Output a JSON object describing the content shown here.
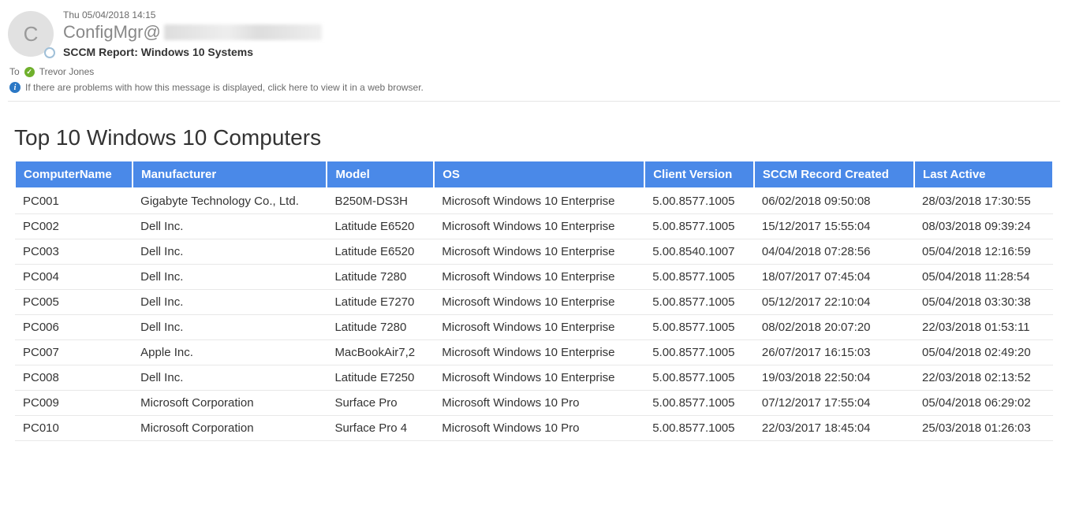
{
  "email": {
    "avatar_initial": "C",
    "date": "Thu 05/04/2018 14:15",
    "from_prefix": "ConfigMgr@",
    "subject": "SCCM Report: Windows 10 Systems",
    "to_label": "To",
    "to_name": "Trevor Jones",
    "info_banner": "If there are problems with how this message is displayed, click here to view it in a web browser."
  },
  "report": {
    "title": "Top 10 Windows 10 Computers",
    "columns": [
      "ComputerName",
      "Manufacturer",
      "Model",
      "OS",
      "Client Version",
      "SCCM Record Created",
      "Last Active"
    ],
    "rows": [
      [
        "PC001",
        "Gigabyte Technology Co., Ltd.",
        "B250M-DS3H",
        "Microsoft Windows 10 Enterprise",
        "5.00.8577.1005",
        "06/02/2018 09:50:08",
        "28/03/2018 17:30:55"
      ],
      [
        "PC002",
        "Dell Inc.",
        "Latitude E6520",
        "Microsoft Windows 10 Enterprise",
        "5.00.8577.1005",
        "15/12/2017 15:55:04",
        "08/03/2018 09:39:24"
      ],
      [
        "PC003",
        "Dell Inc.",
        "Latitude E6520",
        "Microsoft Windows 10 Enterprise",
        "5.00.8540.1007",
        "04/04/2018 07:28:56",
        "05/04/2018 12:16:59"
      ],
      [
        "PC004",
        "Dell Inc.",
        "Latitude 7280",
        "Microsoft Windows 10 Enterprise",
        "5.00.8577.1005",
        "18/07/2017 07:45:04",
        "05/04/2018 11:28:54"
      ],
      [
        "PC005",
        "Dell Inc.",
        "Latitude E7270",
        "Microsoft Windows 10 Enterprise",
        "5.00.8577.1005",
        "05/12/2017 22:10:04",
        "05/04/2018 03:30:38"
      ],
      [
        "PC006",
        "Dell Inc.",
        "Latitude 7280",
        "Microsoft Windows 10 Enterprise",
        "5.00.8577.1005",
        "08/02/2018 20:07:20",
        "22/03/2018 01:53:11"
      ],
      [
        "PC007",
        "Apple Inc.",
        "MacBookAir7,2",
        "Microsoft Windows 10 Enterprise",
        "5.00.8577.1005",
        "26/07/2017 16:15:03",
        "05/04/2018 02:49:20"
      ],
      [
        "PC008",
        "Dell Inc.",
        "Latitude E7250",
        "Microsoft Windows 10 Enterprise",
        "5.00.8577.1005",
        "19/03/2018 22:50:04",
        "22/03/2018 02:13:52"
      ],
      [
        "PC009",
        "Microsoft Corporation",
        "Surface Pro",
        "Microsoft Windows 10 Pro",
        "5.00.8577.1005",
        "07/12/2017 17:55:04",
        "05/04/2018 06:29:02"
      ],
      [
        "PC010",
        "Microsoft Corporation",
        "Surface Pro 4",
        "Microsoft Windows 10 Pro",
        "5.00.8577.1005",
        "22/03/2017 18:45:04",
        "25/03/2018 01:26:03"
      ]
    ]
  }
}
